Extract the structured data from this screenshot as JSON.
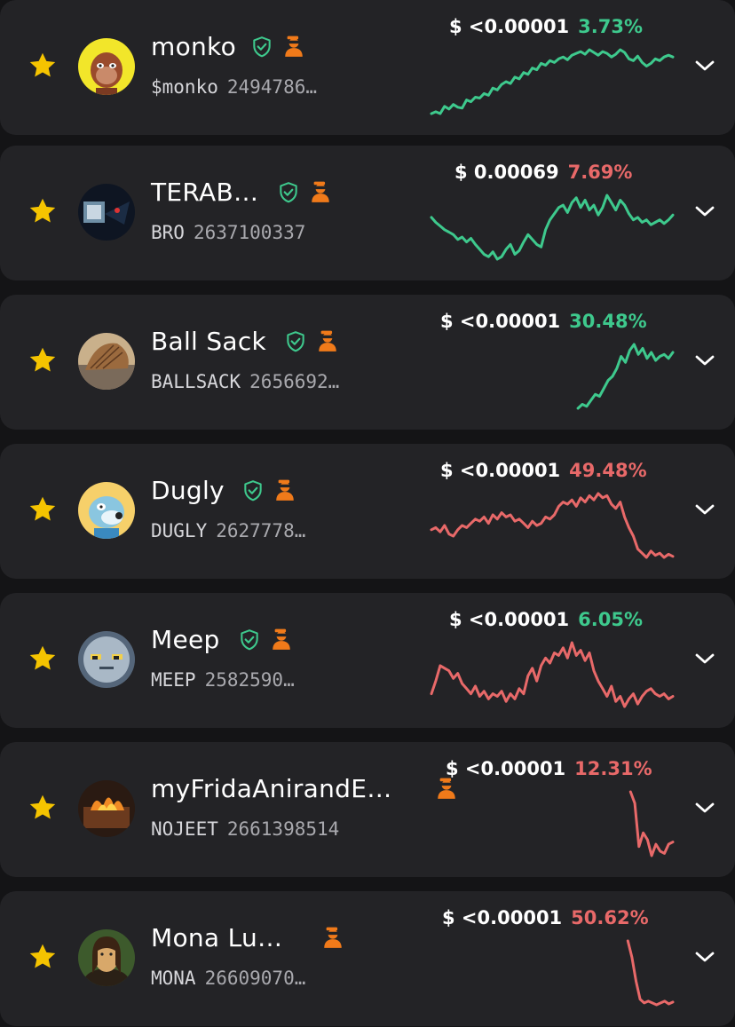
{
  "colors": {
    "up": "#3ec98d",
    "down": "#e86969",
    "star": "#f5c400",
    "verified": "#3ec98d",
    "creator": "#f07a1a"
  },
  "tokens": [
    {
      "name": "monko",
      "symbol": "$monko",
      "id": "2494786…",
      "price": "$ <0.00001",
      "change": "3.73%",
      "change_dir": "up",
      "spark_dir": "up",
      "verified": true,
      "creator_badge": true,
      "avatar_icon": "monkey-avatar-icon",
      "spark": [
        20,
        22,
        20,
        28,
        25,
        30,
        27,
        26,
        35,
        33,
        38,
        37,
        42,
        40,
        48,
        46,
        52,
        55,
        53,
        60,
        58,
        65,
        63,
        70,
        68,
        75,
        73,
        78,
        76,
        80,
        82,
        79,
        84,
        86,
        88,
        85,
        90,
        87,
        84,
        88,
        86,
        82,
        85,
        90,
        87,
        80,
        78,
        83,
        76,
        72,
        75,
        80,
        78,
        82,
        84,
        82
      ]
    },
    {
      "name": "TERAB…",
      "symbol": "BRO",
      "id": "2637100337",
      "price": "$ 0.00069",
      "change": "7.69%",
      "change_dir": "down",
      "spark_dir": "up",
      "verified": true,
      "creator_badge": true,
      "avatar_icon": "terab-avatar-icon",
      "spark": [
        62,
        58,
        55,
        52,
        50,
        48,
        44,
        46,
        42,
        45,
        40,
        36,
        32,
        30,
        34,
        28,
        30,
        36,
        40,
        32,
        35,
        42,
        48,
        44,
        40,
        38,
        52,
        60,
        65,
        70,
        72,
        66,
        74,
        78,
        70,
        76,
        68,
        72,
        64,
        70,
        80,
        74,
        68,
        76,
        72,
        65,
        60,
        62,
        58,
        60,
        56,
        58,
        60,
        57,
        60,
        64
      ]
    },
    {
      "name": "Ball Sack",
      "symbol": "BALLSACK",
      "id": "2656692…",
      "price": "$ <0.00001",
      "change": "30.48%",
      "change_dir": "up",
      "spark_dir": "up",
      "verified": true,
      "creator_badge": true,
      "avatar_icon": "ballsack-avatar-icon",
      "spark": [
        null,
        null,
        null,
        null,
        null,
        null,
        null,
        null,
        null,
        null,
        null,
        null,
        null,
        null,
        null,
        null,
        null,
        null,
        null,
        null,
        null,
        null,
        null,
        null,
        null,
        null,
        null,
        null,
        null,
        null,
        null,
        null,
        null,
        null,
        6,
        10,
        8,
        14,
        20,
        18,
        26,
        34,
        38,
        46,
        58,
        52,
        64,
        70,
        60,
        66,
        56,
        62,
        54,
        58,
        60,
        56,
        62
      ]
    },
    {
      "name": "Dugly",
      "symbol": "DUGLY",
      "id": "2627778…",
      "price": "$ <0.00001",
      "change": "49.48%",
      "change_dir": "down",
      "spark_dir": "down",
      "verified": true,
      "creator_badge": true,
      "avatar_icon": "dog-avatar-icon",
      "spark": [
        38,
        40,
        36,
        42,
        34,
        32,
        38,
        42,
        40,
        44,
        48,
        46,
        50,
        44,
        52,
        48,
        54,
        50,
        52,
        46,
        48,
        44,
        40,
        46,
        42,
        44,
        50,
        48,
        52,
        60,
        64,
        62,
        66,
        60,
        68,
        64,
        70,
        66,
        72,
        68,
        70,
        62,
        58,
        64,
        50,
        40,
        32,
        20,
        16,
        12,
        18,
        14,
        16,
        12,
        15,
        13
      ]
    },
    {
      "name": "Meep",
      "symbol": "MEEP",
      "id": "2582590…",
      "price": "$ <0.00001",
      "change": "6.05%",
      "change_dir": "up",
      "spark_dir": "down",
      "verified": true,
      "creator_badge": true,
      "avatar_icon": "meep-avatar-icon",
      "spark": [
        30,
        40,
        52,
        50,
        48,
        42,
        46,
        38,
        34,
        30,
        36,
        28,
        32,
        26,
        30,
        28,
        32,
        24,
        30,
        26,
        34,
        30,
        44,
        50,
        40,
        52,
        58,
        54,
        62,
        60,
        66,
        58,
        70,
        60,
        64,
        56,
        62,
        48,
        40,
        34,
        28,
        36,
        24,
        28,
        20,
        26,
        30,
        22,
        28,
        32,
        34,
        30,
        28,
        30,
        26,
        28
      ]
    },
    {
      "name": "myFridaAnirandE…",
      "symbol": "NOJEET",
      "id": "2661398514",
      "price": "$ <0.00001",
      "change": "12.31%",
      "change_dir": "down",
      "spark_dir": "down",
      "verified": false,
      "creator_badge": true,
      "avatar_icon": "fire-avatar-icon",
      "spark": [
        null,
        null,
        null,
        null,
        null,
        null,
        null,
        null,
        null,
        null,
        null,
        null,
        null,
        null,
        null,
        null,
        null,
        null,
        null,
        null,
        null,
        null,
        null,
        null,
        null,
        null,
        null,
        null,
        null,
        null,
        null,
        null,
        null,
        null,
        null,
        null,
        null,
        null,
        null,
        null,
        null,
        null,
        null,
        null,
        null,
        null,
        null,
        60,
        50,
        12,
        24,
        18,
        4,
        14,
        8,
        6,
        14,
        16
      ]
    },
    {
      "name": "Mona Lu…",
      "symbol": "MONA",
      "id": "26609070…",
      "price": "$ <0.00001",
      "change": "50.62%",
      "change_dir": "down",
      "spark_dir": "down",
      "verified": false,
      "creator_badge": true,
      "avatar_icon": "mona-avatar-icon",
      "spark": [
        null,
        null,
        null,
        null,
        null,
        null,
        null,
        null,
        null,
        null,
        null,
        null,
        null,
        null,
        null,
        null,
        null,
        null,
        null,
        null,
        null,
        null,
        null,
        null,
        null,
        null,
        null,
        null,
        null,
        null,
        null,
        null,
        null,
        null,
        null,
        null,
        null,
        null,
        null,
        null,
        null,
        null,
        null,
        null,
        null,
        null,
        null,
        null,
        74,
        56,
        30,
        10,
        6,
        8,
        6,
        4,
        6,
        8,
        5,
        7
      ]
    }
  ]
}
